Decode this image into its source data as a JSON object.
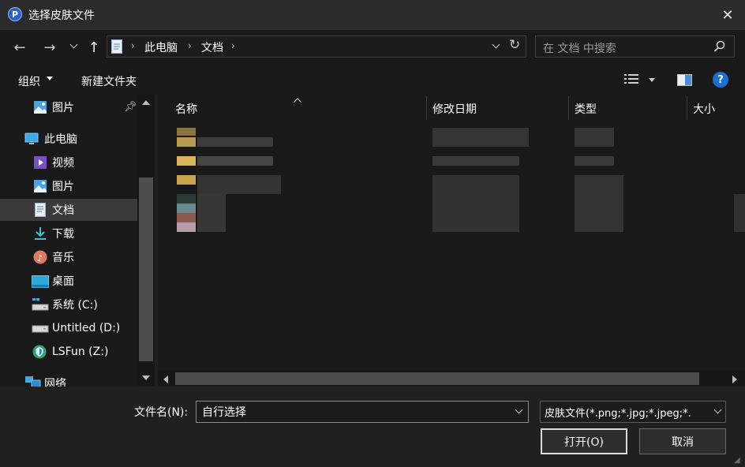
{
  "window": {
    "title": "选择皮肤文件",
    "app_icon_letter": "P"
  },
  "nav": {
    "breadcrumb": [
      "此电脑",
      "文档"
    ],
    "search_placeholder": "在 文档 中搜索"
  },
  "toolbar": {
    "organize_label": "组织",
    "new_folder_label": "新建文件夹"
  },
  "sidebar": {
    "items": [
      {
        "label": "图片",
        "icon": "pictures-icon"
      },
      {
        "label": "此电脑",
        "icon": "computer-icon"
      },
      {
        "label": "视频",
        "icon": "videos-icon"
      },
      {
        "label": "图片",
        "icon": "pictures-icon"
      },
      {
        "label": "文档",
        "icon": "documents-icon",
        "selected": true
      },
      {
        "label": "下载",
        "icon": "download-icon"
      },
      {
        "label": "音乐",
        "icon": "music-icon"
      },
      {
        "label": "桌面",
        "icon": "desktop-icon"
      },
      {
        "label": "系统 (C:)",
        "icon": "drive-c-icon"
      },
      {
        "label": "Untitled (D:)",
        "icon": "drive-d-icon"
      },
      {
        "label": "LSFun (Z:)",
        "icon": "network-drive-icon"
      },
      {
        "label": "网络",
        "icon": "network-icon"
      }
    ]
  },
  "columns": {
    "name": "名称",
    "modified": "修改日期",
    "type": "类型",
    "size": "大小"
  },
  "footer": {
    "filename_label": "文件名(N):",
    "filename_value": "自行选择",
    "filetype_value": "皮肤文件(*.png;*.jpg;*.jpeg;*.",
    "open_label": "打开(O)",
    "cancel_label": "取消"
  },
  "colors": {
    "accent": "#0078d4",
    "background": "#191919",
    "folder": "#d9b45a"
  }
}
